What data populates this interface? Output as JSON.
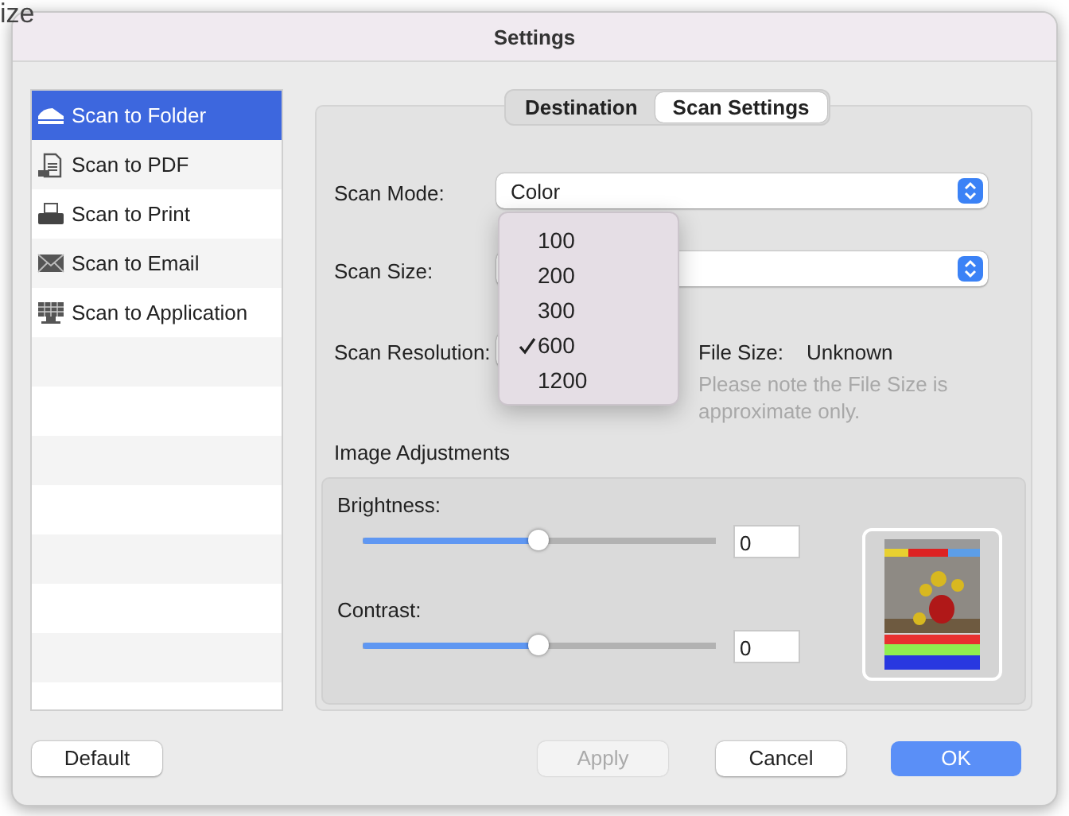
{
  "background_text": [
    "ize"
  ],
  "window": {
    "title": "Settings"
  },
  "sidebar": {
    "items": [
      {
        "label": "Scan to Folder",
        "selected": true
      },
      {
        "label": "Scan to PDF",
        "selected": false
      },
      {
        "label": "Scan to Print",
        "selected": false
      },
      {
        "label": "Scan to Email",
        "selected": false
      },
      {
        "label": "Scan to Application",
        "selected": false
      }
    ]
  },
  "tabs": [
    {
      "label": "Destination",
      "selected": false
    },
    {
      "label": "Scan Settings",
      "selected": true
    }
  ],
  "scan_mode": {
    "label": "Scan Mode:",
    "value": "Color"
  },
  "scan_size": {
    "label": "Scan Size:"
  },
  "scan_resolution": {
    "label": "Scan Resolution:",
    "menu": [
      {
        "label": "100",
        "selected": false
      },
      {
        "label": "200",
        "selected": false
      },
      {
        "label": "300",
        "selected": false
      },
      {
        "label": "600",
        "selected": true
      },
      {
        "label": "1200",
        "selected": false
      }
    ]
  },
  "file_size": {
    "label": "File Size:",
    "value": "Unknown",
    "note": "Please note the File Size is approximate only."
  },
  "image_adjustments": {
    "title": "Image Adjustments",
    "sliders": [
      {
        "label": "Brightness:",
        "level": 0.5,
        "value": "0"
      },
      {
        "label": "Contrast:",
        "level": 0.5,
        "value": "0"
      }
    ]
  },
  "buttons": [
    {
      "label": "Default",
      "primary": false,
      "disabled": false
    },
    {
      "label": "Apply",
      "primary": false,
      "disabled": true
    },
    {
      "label": "Cancel",
      "primary": false,
      "disabled": false
    },
    {
      "label": "OK",
      "primary": true,
      "disabled": false
    }
  ]
}
